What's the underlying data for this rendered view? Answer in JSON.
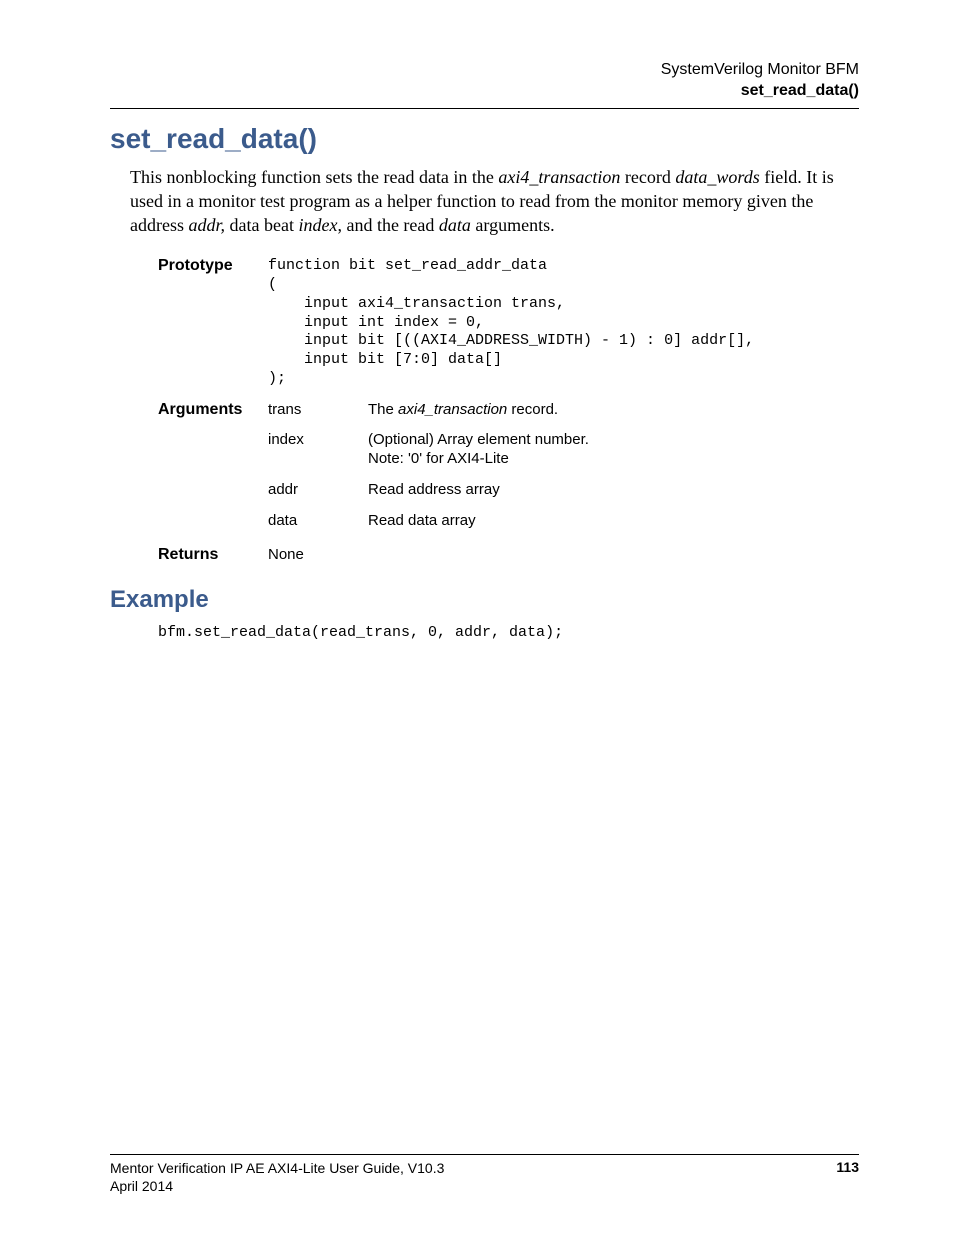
{
  "header": {
    "line1": "SystemVerilog Monitor BFM",
    "line2": "set_read_data()"
  },
  "title": "set_read_data()",
  "intro": {
    "p1a": "This nonblocking function sets the read data in the ",
    "i1": "axi4_transaction",
    "p1b": " record ",
    "i2": "data_words",
    "p1c": " field. It is used in a monitor test program as a helper function to read from the monitor memory given the address ",
    "i3": "addr,",
    "p1d": " data beat ",
    "i4": "index",
    "p1e": ", and the read ",
    "i5": "data",
    "p1f": " arguments."
  },
  "labels": {
    "prototype": "Prototype",
    "arguments": "Arguments",
    "returns": "Returns"
  },
  "prototype_code": "function bit set_read_addr_data\n(\n    input axi4_transaction trans,\n    input int index = 0,\n    input bit [((AXI4_ADDRESS_WIDTH) - 1) : 0] addr[],\n    input bit [7:0] data[]\n);",
  "args": {
    "trans": {
      "name": "trans",
      "desc_a": "The ",
      "desc_i": "axi4_transaction",
      "desc_b": " record."
    },
    "index": {
      "name": "index",
      "desc_a": "(Optional) Array element number.",
      "desc_b": "Note: '0' for AXI4-Lite"
    },
    "addr": {
      "name": "addr",
      "desc": "Read address array"
    },
    "data": {
      "name": "data",
      "desc": "Read data array"
    }
  },
  "returns_value": "None",
  "example_heading": "Example",
  "example_code": "bfm.set_read_data(read_trans, 0, addr, data);",
  "footer": {
    "guide": "Mentor Verification IP AE AXI4-Lite User Guide, V10.3",
    "date": "April 2014",
    "page": "113"
  }
}
